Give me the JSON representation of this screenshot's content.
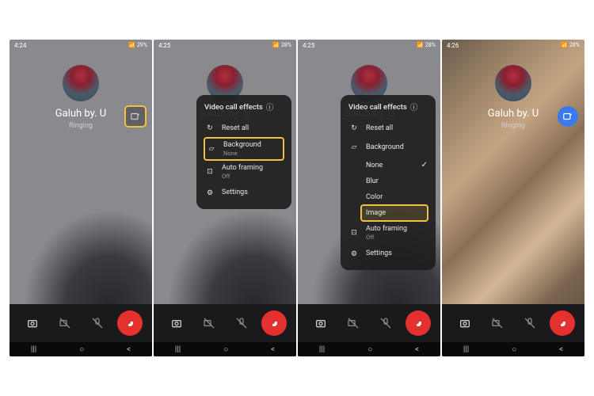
{
  "screens": [
    {
      "time": "4:24",
      "battery": "29%",
      "caller": "Galuh by. U",
      "status": "Ringing",
      "effects_highlighted": true
    },
    {
      "time": "4:25",
      "battery": "28%",
      "caller": "Galuh by. U",
      "status": "Ringing",
      "panel": {
        "title": "Video call effects",
        "items": [
          {
            "icon": "reset",
            "label": "Reset all"
          },
          {
            "icon": "background",
            "label": "Background",
            "sub": "None",
            "highlighted": true
          },
          {
            "icon": "autoframe",
            "label": "Auto framing",
            "sub": "Off"
          },
          {
            "icon": "settings",
            "label": "Settings"
          }
        ]
      }
    },
    {
      "time": "4:25",
      "battery": "28%",
      "caller": "Galuh by. U",
      "status": "Ringing",
      "panel": {
        "title": "Video call effects",
        "items": [
          {
            "icon": "reset",
            "label": "Reset all"
          },
          {
            "icon": "background",
            "label": "Background",
            "expanded": true,
            "options": [
              {
                "label": "None",
                "selected": true
              },
              {
                "label": "Blur"
              },
              {
                "label": "Color"
              },
              {
                "label": "Image",
                "highlighted": true
              }
            ]
          },
          {
            "icon": "autoframe",
            "label": "Auto framing",
            "sub": "Off"
          },
          {
            "icon": "settings",
            "label": "Settings"
          }
        ]
      }
    },
    {
      "time": "4:26",
      "battery": "28%",
      "caller": "Galuh by. U",
      "status": "Ringing",
      "colorful_bg": true,
      "effects_blue": true
    }
  ],
  "bottombar_icons": [
    "camera-switch",
    "video-off",
    "mic-off",
    "end-call"
  ],
  "nav_icons": [
    "recents",
    "home",
    "back"
  ]
}
